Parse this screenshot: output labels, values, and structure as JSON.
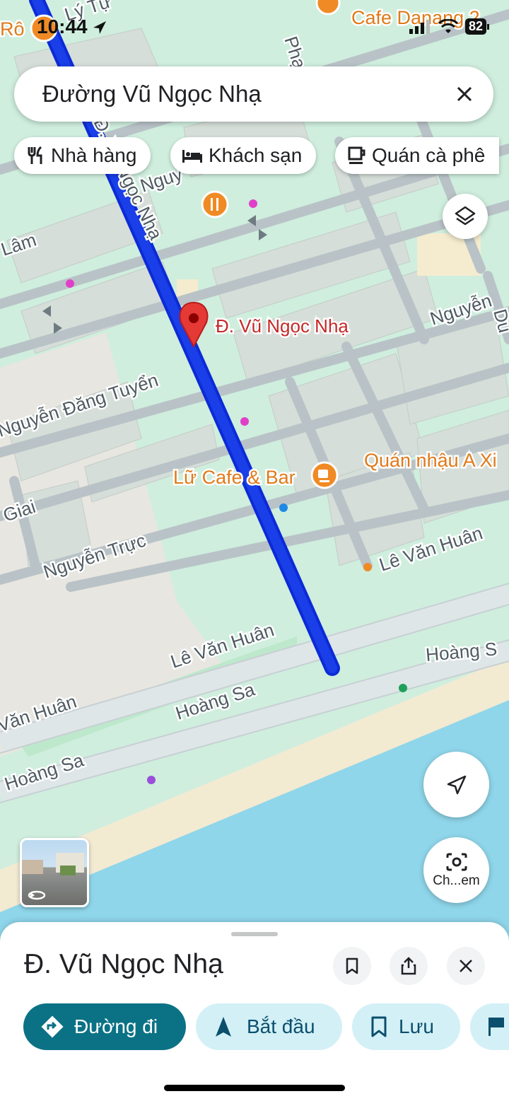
{
  "status_bar": {
    "time": "10:44",
    "battery": "82"
  },
  "search": {
    "query": "Đường Vũ Ngọc Nhạ"
  },
  "chips": [
    {
      "label": "Nhà hàng",
      "icon": "restaurant-icon"
    },
    {
      "label": "Khách sạn",
      "icon": "hotel-icon"
    },
    {
      "label": "Quán cà phê",
      "icon": "cafe-icon"
    }
  ],
  "map": {
    "pin_label": "Đ. Vũ Ngọc Nhạ",
    "labels": {
      "ly_tu": "Lý Tự",
      "ro": "Rô",
      "cafe_danang": "Cafe Danang 2",
      "pha": "Phạ",
      "vu_ngoc_nha_road": "Đ. Vũ Ngọc Nhạ",
      "nguy": "Nguy",
      "lam": "Lâm",
      "nguyen_right": "Nguyễn",
      "du": "Du",
      "nguyen_dang_tuyen": "Nguyễn Đăng Tuyển",
      "lu_cafe": "Lữ Cafe & Bar",
      "quan_nhau": "Quán nhậu A Xi",
      "giai": "Giai",
      "nguyen_truc": "Nguyễn Trực",
      "le_van_huan_1": "Lê Văn Huân",
      "le_van_huan_2": "Lê Văn Huân",
      "le_van_huan_3": "Văn Huân",
      "hoang_sa_1": "Hoàng S",
      "hoang_sa_2": "Hoàng Sa",
      "hoang_sa_3": "Hoàng Sa"
    }
  },
  "camera_button": {
    "label": "Ch...em"
  },
  "sheet": {
    "title": "Đ. Vũ Ngọc Nhạ",
    "actions": [
      {
        "label": "Đường đi",
        "icon": "directions-icon"
      },
      {
        "label": "Bắt đầu",
        "icon": "navigation-arrow-icon"
      },
      {
        "label": "Lưu",
        "icon": "bookmark-icon"
      }
    ]
  },
  "colors": {
    "route": "#1a3ee8",
    "accent": "#0b7285",
    "land": "#cfeede",
    "water": "#8fd6ea",
    "poi_orange": "#f08a24"
  }
}
